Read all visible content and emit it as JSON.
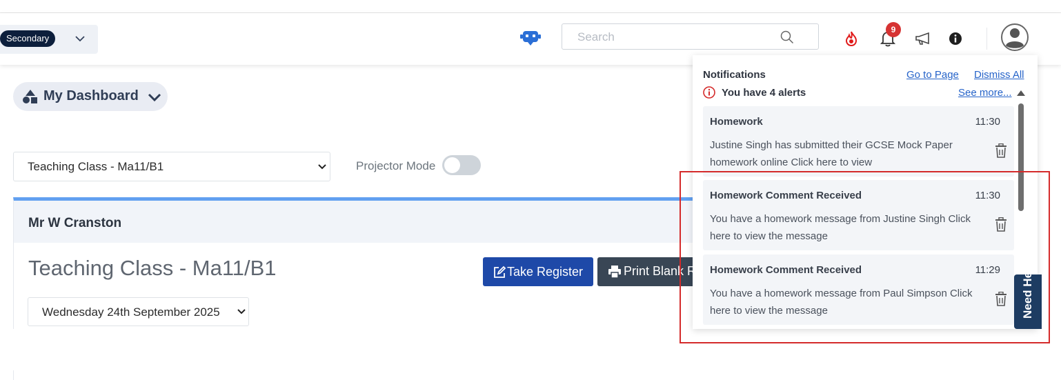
{
  "header": {
    "app_switcher_label": "Secondary",
    "search_placeholder": "Search",
    "notification_count": "9"
  },
  "dashboard": {
    "title": "My Dashboard",
    "class_select_value": "Teaching Class - Ma11/B1",
    "projector_mode_label": "Projector Mode",
    "projector_mode_on": false
  },
  "card": {
    "teacher": "Mr W Cranston",
    "class_title": "Teaching Class - Ma11/B1",
    "take_register_label": "Take Register",
    "print_label": "Print Blank R",
    "date_select_value": "Wednesday 24th September 2025"
  },
  "notifications": {
    "title": "Notifications",
    "go_to_page": "Go to Page",
    "dismiss_all": "Dismiss All",
    "alert_summary": "You have 4 alerts",
    "see_more": "See more...",
    "items": [
      {
        "title": "Homework",
        "time": "11:30",
        "body": "Justine Singh has submitted their GCSE Mock Paper homework online Click here to view"
      },
      {
        "title": "Homework Comment Received",
        "time": "11:30",
        "body": "You have a homework message from Justine Singh Click here to view the message"
      },
      {
        "title": "Homework Comment Received",
        "time": "11:29",
        "body": "You have a homework message from Paul Simpson Click here to view the message"
      }
    ]
  },
  "help_tab": {
    "label": "Need Help"
  },
  "colors": {
    "primary_button": "#1e49a8",
    "secondary_button": "#394655",
    "accent_border": "#62a0f0",
    "badge": "#d63333",
    "highlight": "#d42a2a"
  }
}
